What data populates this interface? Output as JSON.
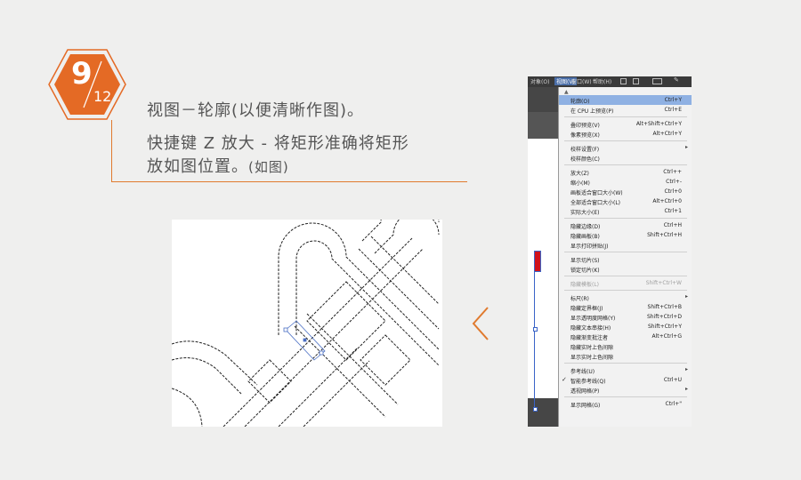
{
  "badge": {
    "step": "9",
    "total": "12",
    "color": "#e46a25"
  },
  "instructions": {
    "line1": "视图－轮廓(以便清晰作图)。",
    "line2": "快捷键 Z 放大 - 将矩形准确将矩形",
    "line3_main": "放如图位置。",
    "line3_note": "(如图)"
  },
  "accent_color": "#e07a2e",
  "nav": {
    "prev_icon": "chevron-left-icon"
  },
  "app": {
    "menubar": {
      "items": [
        {
          "label": "对象(O)",
          "active": false
        },
        {
          "label": "视图(V)",
          "active": true
        },
        {
          "label": "窗口(W)",
          "active": false
        },
        {
          "label": "帮助(H)",
          "active": false
        }
      ]
    },
    "view_menu": {
      "scroll_up": "▲",
      "items": [
        {
          "label": "轮廓(O)",
          "shortcut": "Ctrl+Y",
          "highlight": true
        },
        {
          "label": "在 CPU 上预览(P)",
          "shortcut": "Ctrl+E"
        },
        {
          "label": "叠印预览(V)",
          "shortcut": "Alt+Shift+Ctrl+Y"
        },
        {
          "label": "像素预览(X)",
          "shortcut": "Alt+Ctrl+Y"
        },
        {
          "label": "校样设置(F)",
          "shortcut": "",
          "submenu": true
        },
        {
          "label": "校样颜色(C)",
          "shortcut": ""
        },
        {
          "label": "放大(Z)",
          "shortcut": "Ctrl++"
        },
        {
          "label": "缩小(M)",
          "shortcut": "Ctrl+-"
        },
        {
          "label": "画板适合窗口大小(W)",
          "shortcut": "Ctrl+0"
        },
        {
          "label": "全部适合窗口大小(L)",
          "shortcut": "Alt+Ctrl+0"
        },
        {
          "label": "实际大小(E)",
          "shortcut": "Ctrl+1"
        },
        {
          "label": "隐藏边缘(D)",
          "shortcut": "Ctrl+H"
        },
        {
          "label": "隐藏画板(B)",
          "shortcut": "Shift+Ctrl+H"
        },
        {
          "label": "显示打印拼贴(J)",
          "shortcut": ""
        },
        {
          "label": "显示切片(S)",
          "shortcut": ""
        },
        {
          "label": "锁定切片(K)",
          "shortcut": ""
        },
        {
          "label": "隐藏模板(L)",
          "shortcut": "Shift+Ctrl+W",
          "dim": true
        },
        {
          "label": "标尺(R)",
          "shortcut": "",
          "submenu": true
        },
        {
          "label": "隐藏定界框(J)",
          "shortcut": "Shift+Ctrl+B"
        },
        {
          "label": "显示透明度网格(Y)",
          "shortcut": "Shift+Ctrl+D"
        },
        {
          "label": "隐藏文本串接(H)",
          "shortcut": "Shift+Ctrl+Y"
        },
        {
          "label": "隐藏渐变批注者",
          "shortcut": "Alt+Ctrl+G"
        },
        {
          "label": "隐藏实时上色间隙",
          "shortcut": ""
        },
        {
          "label": "显示实时上色间隙",
          "shortcut": ""
        },
        {
          "label": "参考线(U)",
          "shortcut": "",
          "submenu": true
        },
        {
          "label": "智能参考线(Q)",
          "shortcut": "Ctrl+U",
          "checked": true
        },
        {
          "label": "透视网格(P)",
          "shortcut": "",
          "submenu": true
        },
        {
          "label": "显示网格(G)",
          "shortcut": "Ctrl+\""
        }
      ]
    }
  },
  "preview": {
    "stroke_color": "#222222",
    "selection_color": "#4a6fc4"
  }
}
